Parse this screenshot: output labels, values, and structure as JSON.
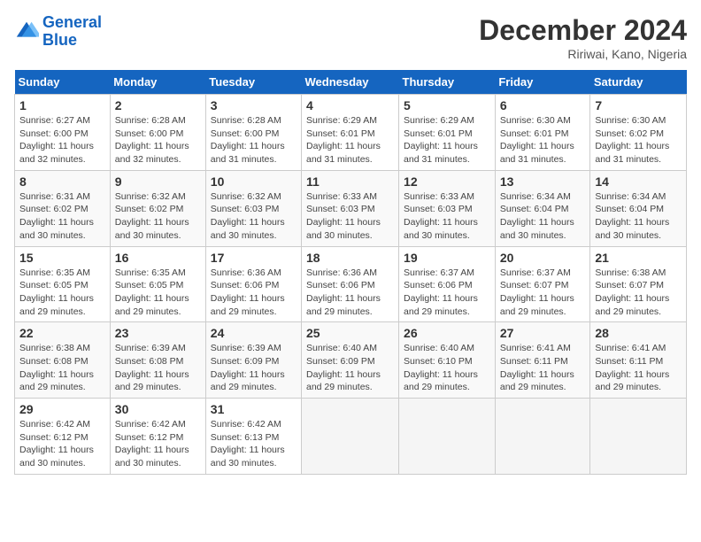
{
  "header": {
    "logo_line1": "General",
    "logo_line2": "Blue",
    "month_title": "December 2024",
    "subtitle": "Ririwai, Kano, Nigeria"
  },
  "weekdays": [
    "Sunday",
    "Monday",
    "Tuesday",
    "Wednesday",
    "Thursday",
    "Friday",
    "Saturday"
  ],
  "weeks": [
    [
      {
        "day": "1",
        "info": "Sunrise: 6:27 AM\nSunset: 6:00 PM\nDaylight: 11 hours\nand 32 minutes."
      },
      {
        "day": "2",
        "info": "Sunrise: 6:28 AM\nSunset: 6:00 PM\nDaylight: 11 hours\nand 32 minutes."
      },
      {
        "day": "3",
        "info": "Sunrise: 6:28 AM\nSunset: 6:00 PM\nDaylight: 11 hours\nand 31 minutes."
      },
      {
        "day": "4",
        "info": "Sunrise: 6:29 AM\nSunset: 6:01 PM\nDaylight: 11 hours\nand 31 minutes."
      },
      {
        "day": "5",
        "info": "Sunrise: 6:29 AM\nSunset: 6:01 PM\nDaylight: 11 hours\nand 31 minutes."
      },
      {
        "day": "6",
        "info": "Sunrise: 6:30 AM\nSunset: 6:01 PM\nDaylight: 11 hours\nand 31 minutes."
      },
      {
        "day": "7",
        "info": "Sunrise: 6:30 AM\nSunset: 6:02 PM\nDaylight: 11 hours\nand 31 minutes."
      }
    ],
    [
      {
        "day": "8",
        "info": "Sunrise: 6:31 AM\nSunset: 6:02 PM\nDaylight: 11 hours\nand 30 minutes."
      },
      {
        "day": "9",
        "info": "Sunrise: 6:32 AM\nSunset: 6:02 PM\nDaylight: 11 hours\nand 30 minutes."
      },
      {
        "day": "10",
        "info": "Sunrise: 6:32 AM\nSunset: 6:03 PM\nDaylight: 11 hours\nand 30 minutes."
      },
      {
        "day": "11",
        "info": "Sunrise: 6:33 AM\nSunset: 6:03 PM\nDaylight: 11 hours\nand 30 minutes."
      },
      {
        "day": "12",
        "info": "Sunrise: 6:33 AM\nSunset: 6:03 PM\nDaylight: 11 hours\nand 30 minutes."
      },
      {
        "day": "13",
        "info": "Sunrise: 6:34 AM\nSunset: 6:04 PM\nDaylight: 11 hours\nand 30 minutes."
      },
      {
        "day": "14",
        "info": "Sunrise: 6:34 AM\nSunset: 6:04 PM\nDaylight: 11 hours\nand 30 minutes."
      }
    ],
    [
      {
        "day": "15",
        "info": "Sunrise: 6:35 AM\nSunset: 6:05 PM\nDaylight: 11 hours\nand 29 minutes."
      },
      {
        "day": "16",
        "info": "Sunrise: 6:35 AM\nSunset: 6:05 PM\nDaylight: 11 hours\nand 29 minutes."
      },
      {
        "day": "17",
        "info": "Sunrise: 6:36 AM\nSunset: 6:06 PM\nDaylight: 11 hours\nand 29 minutes."
      },
      {
        "day": "18",
        "info": "Sunrise: 6:36 AM\nSunset: 6:06 PM\nDaylight: 11 hours\nand 29 minutes."
      },
      {
        "day": "19",
        "info": "Sunrise: 6:37 AM\nSunset: 6:06 PM\nDaylight: 11 hours\nand 29 minutes."
      },
      {
        "day": "20",
        "info": "Sunrise: 6:37 AM\nSunset: 6:07 PM\nDaylight: 11 hours\nand 29 minutes."
      },
      {
        "day": "21",
        "info": "Sunrise: 6:38 AM\nSunset: 6:07 PM\nDaylight: 11 hours\nand 29 minutes."
      }
    ],
    [
      {
        "day": "22",
        "info": "Sunrise: 6:38 AM\nSunset: 6:08 PM\nDaylight: 11 hours\nand 29 minutes."
      },
      {
        "day": "23",
        "info": "Sunrise: 6:39 AM\nSunset: 6:08 PM\nDaylight: 11 hours\nand 29 minutes."
      },
      {
        "day": "24",
        "info": "Sunrise: 6:39 AM\nSunset: 6:09 PM\nDaylight: 11 hours\nand 29 minutes."
      },
      {
        "day": "25",
        "info": "Sunrise: 6:40 AM\nSunset: 6:09 PM\nDaylight: 11 hours\nand 29 minutes."
      },
      {
        "day": "26",
        "info": "Sunrise: 6:40 AM\nSunset: 6:10 PM\nDaylight: 11 hours\nand 29 minutes."
      },
      {
        "day": "27",
        "info": "Sunrise: 6:41 AM\nSunset: 6:11 PM\nDaylight: 11 hours\nand 29 minutes."
      },
      {
        "day": "28",
        "info": "Sunrise: 6:41 AM\nSunset: 6:11 PM\nDaylight: 11 hours\nand 29 minutes."
      }
    ],
    [
      {
        "day": "29",
        "info": "Sunrise: 6:42 AM\nSunset: 6:12 PM\nDaylight: 11 hours\nand 30 minutes."
      },
      {
        "day": "30",
        "info": "Sunrise: 6:42 AM\nSunset: 6:12 PM\nDaylight: 11 hours\nand 30 minutes."
      },
      {
        "day": "31",
        "info": "Sunrise: 6:42 AM\nSunset: 6:13 PM\nDaylight: 11 hours\nand 30 minutes."
      },
      {
        "day": "",
        "info": ""
      },
      {
        "day": "",
        "info": ""
      },
      {
        "day": "",
        "info": ""
      },
      {
        "day": "",
        "info": ""
      }
    ]
  ]
}
